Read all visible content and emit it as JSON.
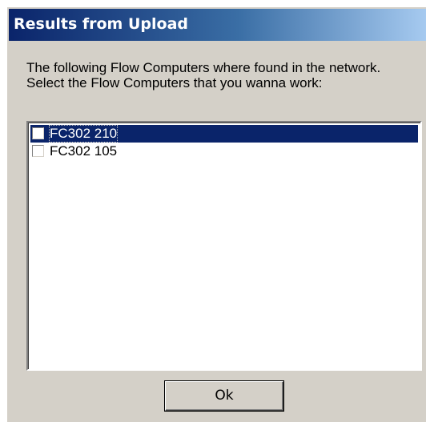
{
  "dialog": {
    "title": "Results from Upload",
    "message": "The following Flow Computers where found in the network. Select the Flow Computers that you wanna work:",
    "items": [
      {
        "label": "FC302 210",
        "checked": false,
        "selected": true
      },
      {
        "label": "FC302 105",
        "checked": false,
        "selected": false
      }
    ],
    "ok_label": "Ok"
  },
  "colors": {
    "titlebar_start": "#0a246a",
    "titlebar_end": "#a6caf0",
    "selection": "#0a246a",
    "dialog_face": "#d4d0c8"
  }
}
